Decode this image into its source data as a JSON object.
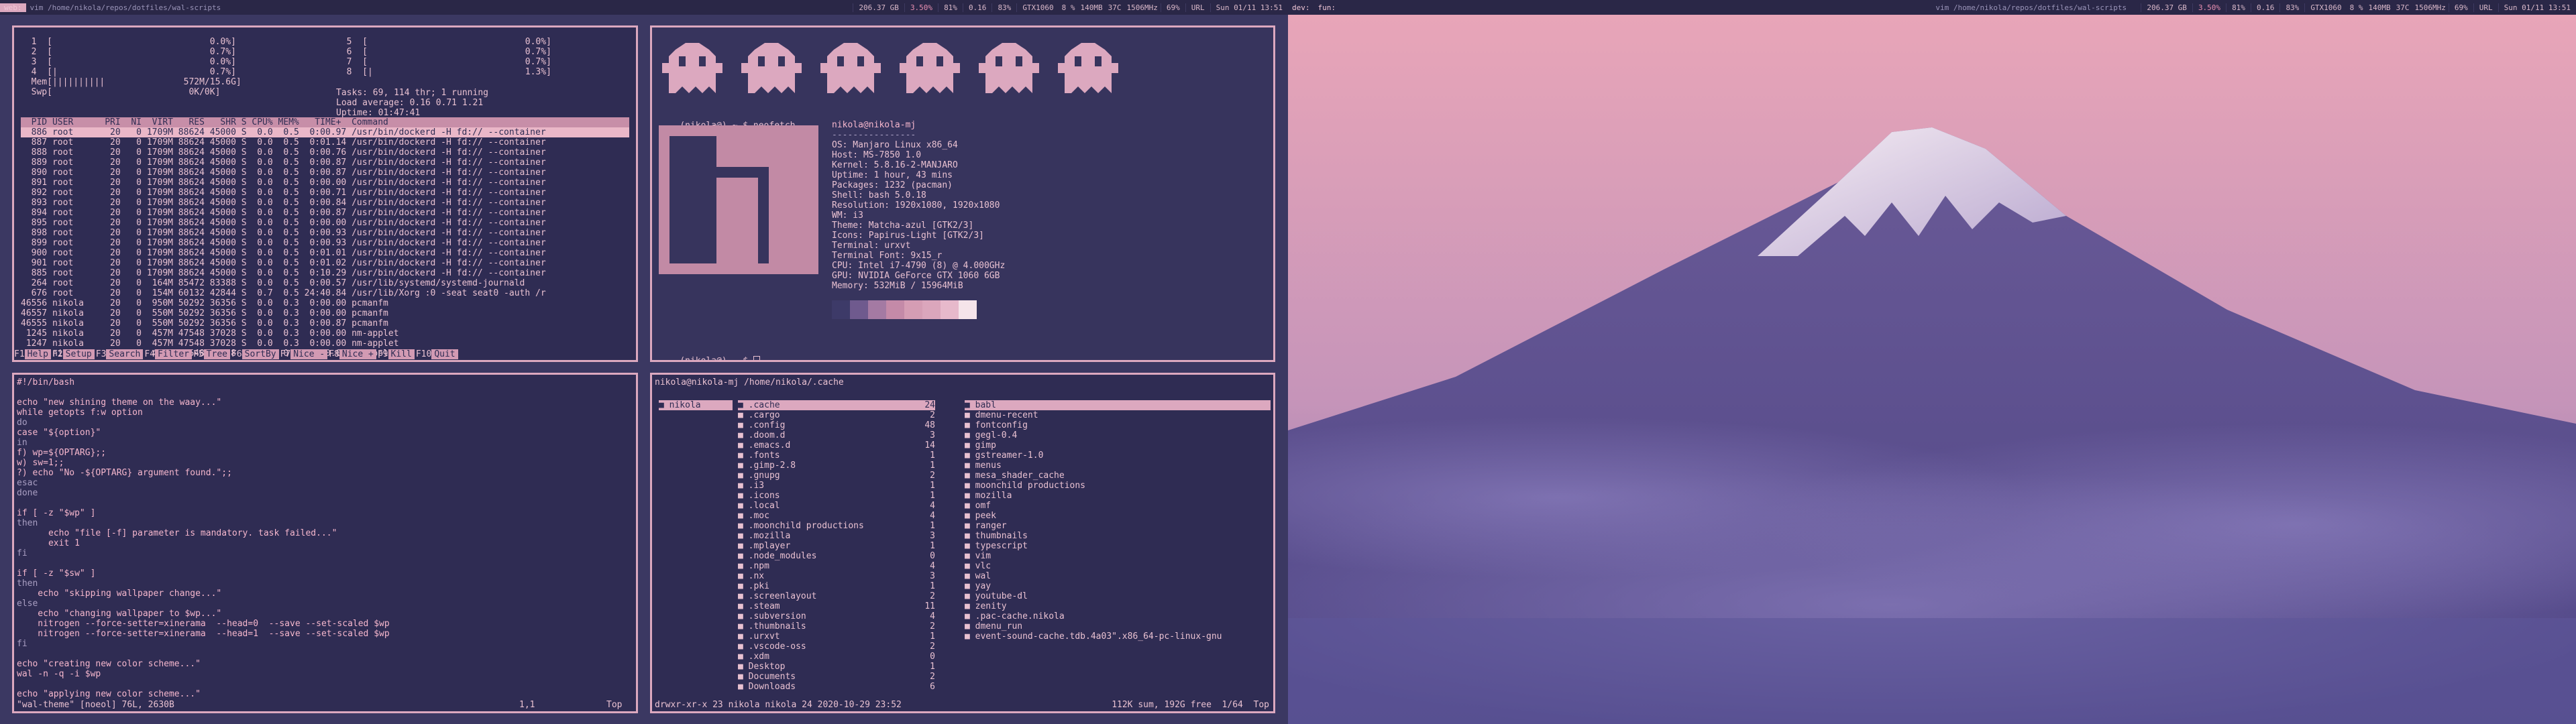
{
  "topbar": {
    "left": {
      "workspace": "web:",
      "window_title": "vim /home/nikola/repos/dotfiles/wal-scripts",
      "disk": "206.37 GB",
      "cpu": "3.50%",
      "ram": "81%",
      "load": "0.16",
      "vol": "83%",
      "gpu": "GTX1060",
      "gpu_util": "8 %",
      "gpu_mem": "140MB",
      "gpu_temp": "37C",
      "gpu_clock": "1506MHz",
      "battery": "69%",
      "net": "URL",
      "datetime": "Sun 01/11 13:51"
    },
    "right": {
      "workspace": "dev:",
      "window_label": "fun:",
      "window_title": "vim /home/nikola/repos/dotfiles/wal-scripts",
      "disk": "206.37 GB",
      "cpu": "3.50%",
      "ram": "81%",
      "load": "0.16",
      "vol": "83%",
      "gpu": "GTX1060",
      "gpu_util": "8 %",
      "gpu_mem": "140MB",
      "gpu_temp": "37C",
      "gpu_clock": "1506MHz",
      "battery": "69%",
      "net": "URL",
      "datetime": "Sun 01/11 13:51"
    }
  },
  "htop": {
    "cpus_left": [
      "  1  [                              0.0%]",
      "  2  [                              0.7%]",
      "  3  [                              0.0%]",
      "  4  [|                             0.7%]"
    ],
    "cpus_right": [
      "  5  [                              0.0%]",
      "  6  [                              0.7%]",
      "  7  [                              0.7%]",
      "  8  [|                             1.3%]"
    ],
    "mem": "  Mem[||||||||||               572M/15.6G]",
    "swp": "  Swp[                          0K/0K]",
    "tasks": "Tasks: 69, 114 thr; 1 running",
    "load": "Load average: 0.16 0.71 1.21",
    "uptime": "Uptime: 01:47:41",
    "header": "  PID USER      PRI  NI  VIRT   RES   SHR S CPU% MEM%   TIME+  Command",
    "rows": [
      "  886 root       20   0 1709M 88624 45000 S  0.0  0.5  0:00.97 /usr/bin/dockerd -H fd:// --container",
      "  887 root       20   0 1709M 88624 45000 S  0.0  0.5  0:01.14 /usr/bin/dockerd -H fd:// --container",
      "  888 root       20   0 1709M 88624 45000 S  0.0  0.5  0:00.76 /usr/bin/dockerd -H fd:// --container",
      "  889 root       20   0 1709M 88624 45000 S  0.0  0.5  0:00.87 /usr/bin/dockerd -H fd:// --container",
      "  890 root       20   0 1709M 88624 45000 S  0.0  0.5  0:00.87 /usr/bin/dockerd -H fd:// --container",
      "  891 root       20   0 1709M 88624 45000 S  0.0  0.5  0:00.00 /usr/bin/dockerd -H fd:// --container",
      "  892 root       20   0 1709M 88624 45000 S  0.0  0.5  0:00.71 /usr/bin/dockerd -H fd:// --container",
      "  893 root       20   0 1709M 88624 45000 S  0.0  0.5  0:00.84 /usr/bin/dockerd -H fd:// --container",
      "  894 root       20   0 1709M 88624 45000 S  0.0  0.5  0:00.87 /usr/bin/dockerd -H fd:// --container",
      "  895 root       20   0 1709M 88624 45000 S  0.0  0.5  0:00.00 /usr/bin/dockerd -H fd:// --container",
      "  898 root       20   0 1709M 88624 45000 S  0.0  0.5  0:00.93 /usr/bin/dockerd -H fd:// --container",
      "  899 root       20   0 1709M 88624 45000 S  0.0  0.5  0:00.93 /usr/bin/dockerd -H fd:// --container",
      "  900 root       20   0 1709M 88624 45000 S  0.0  0.5  0:01.01 /usr/bin/dockerd -H fd:// --container",
      "  901 root       20   0 1709M 88624 45000 S  0.0  0.5  0:01.02 /usr/bin/dockerd -H fd:// --container",
      "  885 root       20   0 1709M 88624 45000 S  0.0  0.5  0:10.29 /usr/bin/dockerd -H fd:// --container",
      "  264 root       20   0  164M 85472 83388 S  0.0  0.5  0:00.57 /usr/lib/systemd/systemd-journald",
      "  676 root       20   0  154M 60132 42844 S  0.7  0.5 24:40.84 /usr/lib/Xorg :0 -seat seat0 -auth /r",
      "46556 nikola     20   0  950M 50292 36356 S  0.0  0.3  0:00.00 pcmanfm",
      "46557 nikola     20   0  550M 50292 36356 S  0.0  0.3  0:00.00 pcmanfm",
      "46555 nikola     20   0  550M 50292 36356 S  0.0  0.3  0:00.87 pcmanfm",
      " 1245 nikola     20   0  457M 47548 37028 S  0.0  0.3  0:00.00 nm-applet",
      " 1247 nikola     20   0  457M 47548 37028 S  0.0  0.3  0:00.00 nm-applet",
      " 1267 nikola     20   0  457M 47548 37028 S  0.0  0.3  0:00.00 nm-applet"
    ],
    "fkeys": [
      {
        "k": "F1",
        "l": "Help"
      },
      {
        "k": "F2",
        "l": "Setup"
      },
      {
        "k": "F3",
        "l": "Search"
      },
      {
        "k": "F4",
        "l": "Filter"
      },
      {
        "k": "F5",
        "l": "Tree"
      },
      {
        "k": "F6",
        "l": "SortBy"
      },
      {
        "k": "F7",
        "l": "Nice -"
      },
      {
        "k": "F8",
        "l": "Nice +"
      },
      {
        "k": "F9",
        "l": "Kill"
      },
      {
        "k": "F10",
        "l": "Quit"
      }
    ]
  },
  "neofetch": {
    "prompt1": "(nikola@) ~ $ neofetch",
    "userhost": "nikola@nikola-mj",
    "sep": "----------------",
    "info": [
      "OS: Manjaro Linux x86_64",
      "Host: MS-7850 1.0",
      "Kernel: 5.8.16-2-MANJARO",
      "Uptime: 1 hour, 43 mins",
      "Packages: 1232 (pacman)",
      "Shell: bash 5.0.18",
      "Resolution: 1920x1080, 1920x1080",
      "WM: i3",
      "Theme: Matcha-azul [GTK2/3]",
      "Icons: Papirus-Light [GTK2/3]",
      "Terminal: urxvt",
      "Terminal Font: 9x15_r",
      "CPU: Intel i7-4790 (8) @ 4.000GHz",
      "GPU: NVIDIA GeForce GTX 1060 6GB",
      "Memory: 532MiB / 15964MiB"
    ],
    "palette": [
      "#3d3a68",
      "#6f5a8e",
      "#a47aa3",
      "#c48aa8",
      "#d59db4",
      "#dba6bc",
      "#e7b9cb",
      "#f5e4ea"
    ],
    "prompt2": "(nikola@) ~ $ "
  },
  "vim": {
    "lines": [
      {
        "t": "#!/bin/bash",
        "c": "pink"
      },
      {
        "t": "",
        "c": ""
      },
      {
        "t": "echo \"new shining theme on the waay...\"",
        "c": "pink"
      },
      {
        "t": "while getopts f:w option",
        "c": "pink"
      },
      {
        "t": "do",
        "c": "dim"
      },
      {
        "t": "case \"${option}\"",
        "c": "pink"
      },
      {
        "t": "in",
        "c": "dim"
      },
      {
        "t": "f) wp=${OPTARG};;",
        "c": "pink"
      },
      {
        "t": "w) sw=1;;",
        "c": "pink"
      },
      {
        "t": "?) echo \"No -${OPTARG} argument found.\";;",
        "c": "pink"
      },
      {
        "t": "esac",
        "c": "dim"
      },
      {
        "t": "done",
        "c": "dim"
      },
      {
        "t": "",
        "c": ""
      },
      {
        "t": "if [ -z \"$wp\" ]",
        "c": "pink"
      },
      {
        "t": "then",
        "c": "dim"
      },
      {
        "t": "      echo \"file [-f] parameter is mandatory. task failed...\"",
        "c": "pink"
      },
      {
        "t": "      exit 1",
        "c": "pink"
      },
      {
        "t": "fi",
        "c": "dim"
      },
      {
        "t": "",
        "c": ""
      },
      {
        "t": "if [ -z \"$sw\" ]",
        "c": "pink"
      },
      {
        "t": "then",
        "c": "dim"
      },
      {
        "t": "    echo \"skipping wallpaper change...\"",
        "c": "pink"
      },
      {
        "t": "else",
        "c": "dim"
      },
      {
        "t": "    echo \"changing wallpaper to $wp...\"",
        "c": "pink"
      },
      {
        "t": "    nitrogen --force-setter=xinerama  --head=0  --save --set-scaled $wp",
        "c": "pink"
      },
      {
        "t": "    nitrogen --force-setter=xinerama  --head=1  --save --set-scaled $wp",
        "c": "pink"
      },
      {
        "t": "fi",
        "c": "dim"
      },
      {
        "t": "",
        "c": ""
      },
      {
        "t": "echo \"creating new color scheme...\"",
        "c": "pink"
      },
      {
        "t": "wal -n -q -i $wp",
        "c": "pink"
      },
      {
        "t": "",
        "c": ""
      },
      {
        "t": "echo \"applying new color scheme...\"",
        "c": "pink"
      }
    ],
    "status_left": "\"wal-theme\" [noeol] 76L, 2630B",
    "status_pos": "1,1",
    "status_right": "Top"
  },
  "ranger": {
    "header": "nikola@nikola-mj /home/nikola/.cache",
    "parent": [
      {
        "n": "nikola",
        "c": ""
      }
    ],
    "middle": [
      {
        "n": ".cache",
        "c": "24"
      },
      {
        "n": ".cargo",
        "c": "2"
      },
      {
        "n": ".config",
        "c": "48"
      },
      {
        "n": ".doom.d",
        "c": "3"
      },
      {
        "n": ".emacs.d",
        "c": "14"
      },
      {
        "n": ".fonts",
        "c": "1"
      },
      {
        "n": ".gimp-2.8",
        "c": "1"
      },
      {
        "n": ".gnupg",
        "c": "2"
      },
      {
        "n": ".i3",
        "c": "1"
      },
      {
        "n": ".icons",
        "c": "1"
      },
      {
        "n": ".local",
        "c": "4"
      },
      {
        "n": ".moc",
        "c": "4"
      },
      {
        "n": ".moonchild productions",
        "c": "1"
      },
      {
        "n": ".mozilla",
        "c": "3"
      },
      {
        "n": ".mplayer",
        "c": "1"
      },
      {
        "n": ".node_modules",
        "c": "0"
      },
      {
        "n": ".npm",
        "c": "4"
      },
      {
        "n": ".nx",
        "c": "3"
      },
      {
        "n": ".pki",
        "c": "1"
      },
      {
        "n": ".screenlayout",
        "c": "2"
      },
      {
        "n": ".steam",
        "c": "11"
      },
      {
        "n": ".subversion",
        "c": "4"
      },
      {
        "n": ".thumbnails",
        "c": "2"
      },
      {
        "n": ".urxvt",
        "c": "1"
      },
      {
        "n": ".vscode-oss",
        "c": "2"
      },
      {
        "n": ".xdm",
        "c": "0"
      },
      {
        "n": "Desktop",
        "c": "1"
      },
      {
        "n": "Documents",
        "c": "2"
      },
      {
        "n": "Downloads",
        "c": "6"
      }
    ],
    "right": [
      "babl",
      "dmenu-recent",
      "fontconfig",
      "gegl-0.4",
      "gimp",
      "gstreamer-1.0",
      "menus",
      "mesa_shader_cache",
      "moonchild productions",
      "mozilla",
      "omf",
      "peek",
      "ranger",
      "thumbnails",
      "typescript",
      "vim",
      "vlc",
      "wal",
      "yay",
      "youtube-dl",
      "zenity",
      ".pac-cache.nikola",
      "dmenu_run",
      "event-sound-cache.tdb.4a03\".x86_64-pc-linux-gnu"
    ],
    "status_left": "drwxr-xr-x 23 nikola nikola 24 2020-10-29 23:52",
    "status_right": "112K sum, 192G free  1/64  Top"
  },
  "colors": {
    "wallpaper_sky_top": "#e8a5b8",
    "wallpaper_sky_bottom": "#6c62a5",
    "mountain": "#4a3f7a",
    "snow": "#efe5f0"
  }
}
